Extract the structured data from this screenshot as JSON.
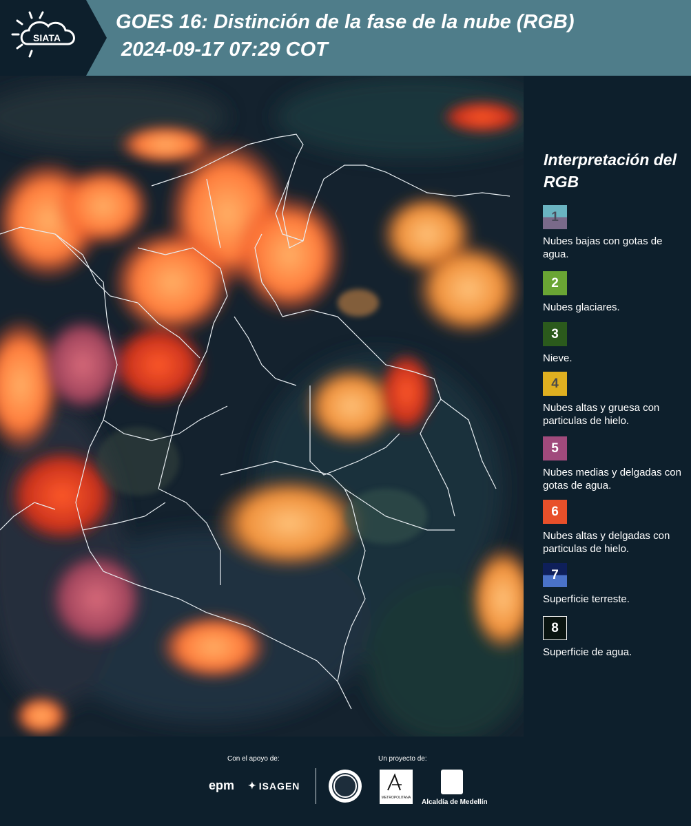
{
  "header": {
    "logo_text": "SIATA",
    "title_line1": "GOES 16: Distinción de la fase de la nube (RGB)",
    "title_line2": "2024-09-17 07:29 COT"
  },
  "legend": {
    "title": "Interpretación del RGB",
    "items": [
      {
        "num": "1",
        "label": "Nubes bajas con gotas de agua.",
        "color_top": "#6ab4c2",
        "color_bottom": "#7a6a8a",
        "num_color": "#4a4a5a"
      },
      {
        "num": "2",
        "label": "Nubes glaciares.",
        "color_top": "#6aa534",
        "color_bottom": "#6aa534",
        "num_color": "#ffffff"
      },
      {
        "num": "3",
        "label": "Nieve.",
        "color_top": "#2b5a1c",
        "color_bottom": "#2b5a1c",
        "num_color": "#ffffff"
      },
      {
        "num": "4",
        "label": "Nubes altas y gruesa con particulas de hielo.",
        "color_top": "#e0b020",
        "color_bottom": "#e0b020",
        "num_color": "#4a4a4a"
      },
      {
        "num": "5",
        "label": "Nubes medias y delgadas con gotas de agua.",
        "color_top": "#a04a7c",
        "color_bottom": "#a04a7c",
        "num_color": "#ffffff"
      },
      {
        "num": "6",
        "label": "Nubes altas y delgadas con particulas de hielo.",
        "color_top": "#e8502a",
        "color_bottom": "#e8502a",
        "num_color": "#ffffff"
      },
      {
        "num": "7",
        "label": "Superficie terreste.",
        "color_top": "#0e1f5a",
        "color_bottom": "#4a72c8",
        "num_color": "#ffffff"
      },
      {
        "num": "8",
        "label": "Superficie de agua.",
        "color_top": "#0a1410",
        "color_bottom": "#0a1410",
        "num_color": "#ffffff"
      }
    ]
  },
  "footer": {
    "support_label": "Con el apoyo de:",
    "project_label": "Un proyecto de:",
    "sponsor_1": "epm",
    "sponsor_2": "ISAGEN",
    "partner_area": "METROPOLITANA",
    "partner_alcaldia": "Alcaldía de Medellín"
  }
}
